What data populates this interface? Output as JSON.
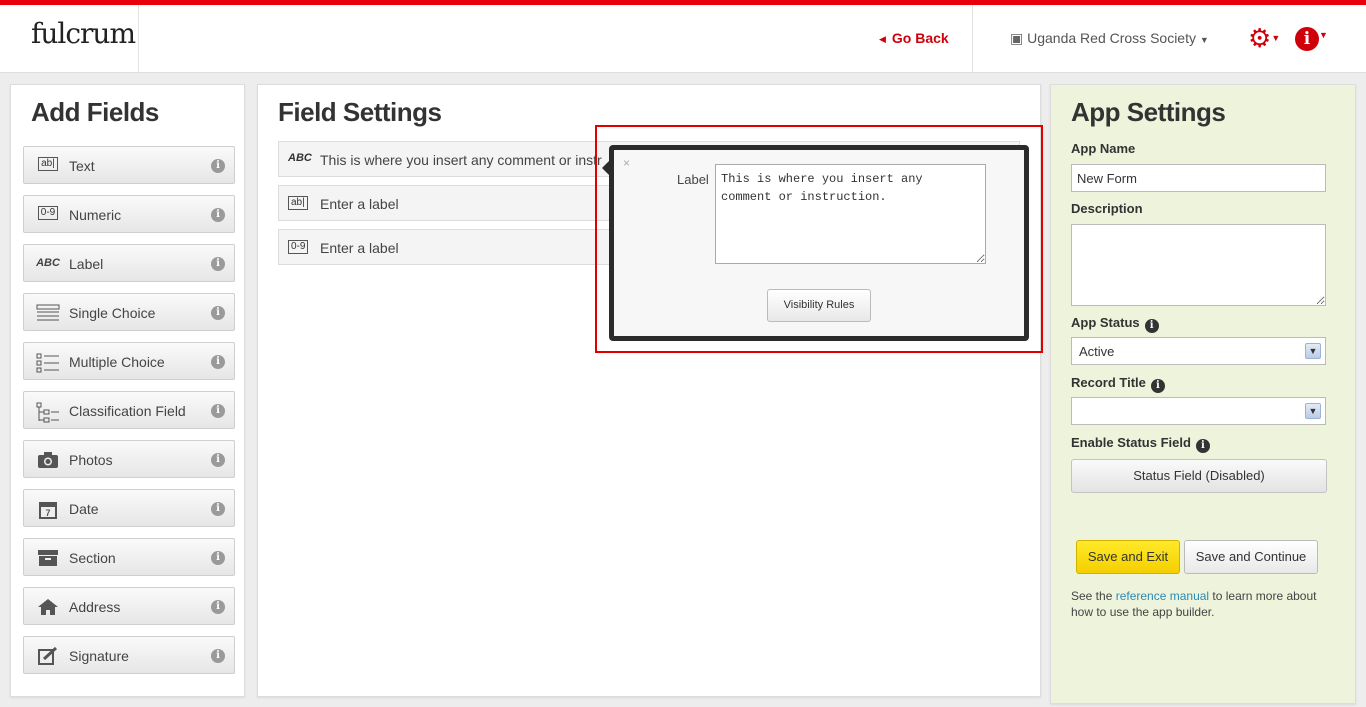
{
  "header": {
    "logo": "fulcrum",
    "go_back": "Go Back",
    "organization": "Uganda Red Cross Society"
  },
  "add_fields": {
    "title": "Add Fields",
    "items": [
      {
        "label": "Text",
        "icon": "text-field-icon",
        "glyph": "ab|"
      },
      {
        "label": "Numeric",
        "icon": "numeric-field-icon",
        "glyph": "0-9"
      },
      {
        "label": "Label",
        "icon": "label-field-icon",
        "glyph": "ABC"
      },
      {
        "label": "Single Choice",
        "icon": "single-choice-icon",
        "glyph": "▤"
      },
      {
        "label": "Multiple Choice",
        "icon": "multiple-choice-icon",
        "glyph": "☑"
      },
      {
        "label": "Classification Field",
        "icon": "classification-field-icon",
        "glyph": "⊟"
      },
      {
        "label": "Photos",
        "icon": "camera-icon",
        "glyph": "📷"
      },
      {
        "label": "Date",
        "icon": "calendar-icon",
        "glyph": "7"
      },
      {
        "label": "Section",
        "icon": "section-icon",
        "glyph": "▭"
      },
      {
        "label": "Address",
        "icon": "home-icon",
        "glyph": "⌂"
      },
      {
        "label": "Signature",
        "icon": "signature-icon",
        "glyph": "✎"
      }
    ]
  },
  "field_settings": {
    "title": "Field Settings",
    "rows": [
      {
        "glyph": "ABC",
        "text": "This is where you insert any comment or instr"
      },
      {
        "glyph": "ab|",
        "text": "Enter a label"
      },
      {
        "glyph": "0-9",
        "text": "Enter a label"
      }
    ]
  },
  "popover": {
    "close": "×",
    "label": "Label",
    "value": "This is where you insert any comment or instruction.",
    "visibility_button": "Visibility Rules"
  },
  "app_settings": {
    "title": "App Settings",
    "app_name_label": "App Name",
    "app_name_value": "New Form",
    "description_label": "Description",
    "app_status_label": "App Status",
    "app_status_value": "Active",
    "record_title_label": "Record Title",
    "record_title_value": "",
    "enable_status_label": "Enable Status Field",
    "status_button": "Status Field (Disabled)",
    "save_exit": "Save and Exit",
    "save_continue": "Save and Continue",
    "ref_prefix": "See the ",
    "ref_link": "reference manual",
    "ref_suffix": " to learn more about how to use the app builder."
  },
  "colors": {
    "accent_red": "#e8000b",
    "save_yellow": "#ffe92a",
    "settings_bg": "#eef3dc",
    "link_blue": "#2a8bb8"
  }
}
